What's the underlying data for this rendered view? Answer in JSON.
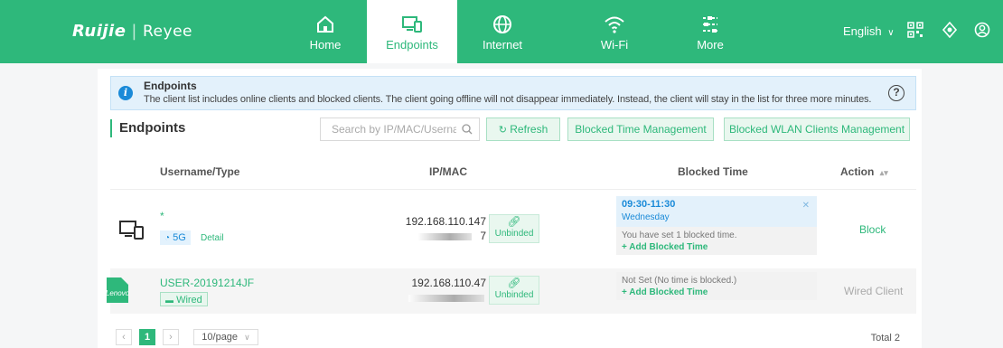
{
  "brand": {
    "logo": "Ruijie",
    "sub": "Reyee"
  },
  "nav": [
    {
      "label": "Home",
      "icon": "home-icon"
    },
    {
      "label": "Endpoints",
      "icon": "endpoints-icon",
      "active": true
    },
    {
      "label": "Internet",
      "icon": "globe-icon"
    },
    {
      "label": "Wi-Fi",
      "icon": "wifi-icon"
    },
    {
      "label": "More",
      "icon": "more-settings-icon"
    }
  ],
  "header": {
    "language": "English"
  },
  "info": {
    "title": "Endpoints",
    "text": "The client list includes online clients and blocked clients. The client going offline will not disappear immediately. Instead, the client will stay in the list for three more minutes."
  },
  "section": {
    "title": "Endpoints",
    "search_placeholder": "Search by IP/MAC/Username",
    "refresh": "Refresh",
    "blocked_time_mgmt": "Blocked Time Management",
    "blocked_wlan_mgmt": "Blocked WLAN Clients Management"
  },
  "table": {
    "headers": {
      "username": "Username/Type",
      "ipmac": "IP/MAC",
      "blocked": "Blocked Time",
      "action": "Action"
    },
    "rows": [
      {
        "username": "*",
        "type": "5G",
        "detail": "Detail",
        "ip": "192.168.110.147",
        "mac_tail": "7",
        "bind": "Unbinded",
        "blocked_entry_time": "09:30-11:30",
        "blocked_entry_day": "Wednesday",
        "blocked_note": "You have set 1 blocked time.",
        "add_blocked": "Add Blocked Time",
        "action": "Block"
      },
      {
        "username": "USER-20191214JF",
        "type": "Wired",
        "badge": "Lenovo",
        "ip": "192.168.110.47",
        "bind": "Unbinded",
        "blocked_note": "Not Set (No time is blocked.)",
        "add_blocked": "Add Blocked Time",
        "action": "Wired Client"
      }
    ]
  },
  "pagination": {
    "current": "1",
    "per_page": "10/page",
    "total": "Total 2"
  },
  "colors": {
    "brand": "#2eb87b",
    "info_blue": "#1a8ad8",
    "info_bg": "#e3f1fb"
  }
}
